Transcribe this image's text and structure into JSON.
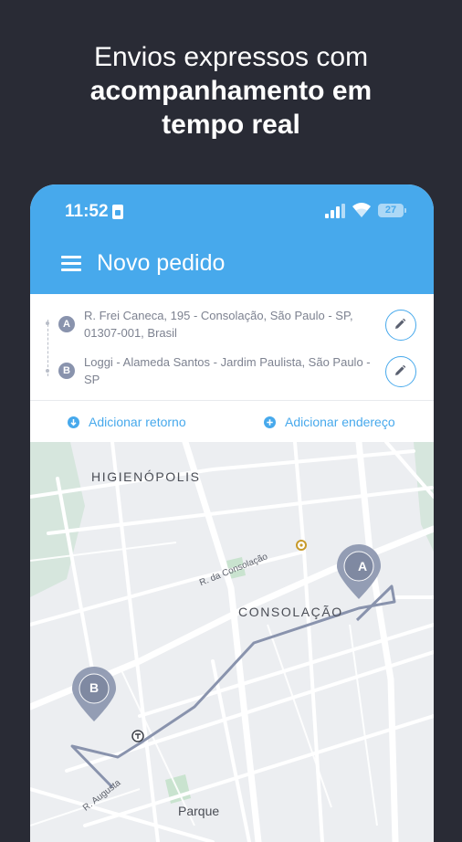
{
  "headline": {
    "line1": "Envios expressos com",
    "line2": "acompanhamento em",
    "line3": "tempo real"
  },
  "status_bar": {
    "time": "11:52",
    "battery": "27"
  },
  "app_bar": {
    "title": "Novo pedido"
  },
  "addresses": [
    {
      "marker": "A",
      "text": "R. Frei Caneca, 195 - Consolação, São Paulo - SP, 01307-001, Brasil"
    },
    {
      "marker": "B",
      "text": "Loggi - Alameda Santos - Jardim Paulista, São Paulo - SP"
    }
  ],
  "actions": {
    "add_return": "Adicionar retorno",
    "add_address": "Adicionar endereço"
  },
  "map": {
    "neighborhoods": [
      "HIGIENÓPOLIS",
      "CONSOLAÇÃO",
      "Parque"
    ],
    "streets": [
      "R. da Consolação",
      "R. Augusta"
    ],
    "pins": [
      "A",
      "B"
    ]
  },
  "colors": {
    "brand_blue": "#47a9ec",
    "background": "#292b35",
    "route": "#8993ad"
  },
  "icons": [
    "menu-icon",
    "sim-card-icon",
    "signal-icon",
    "wifi-icon",
    "battery-icon",
    "edit-pencil-icon",
    "arrow-down-circle-icon",
    "plus-circle-icon",
    "metro-icon",
    "place-marker-icon"
  ]
}
